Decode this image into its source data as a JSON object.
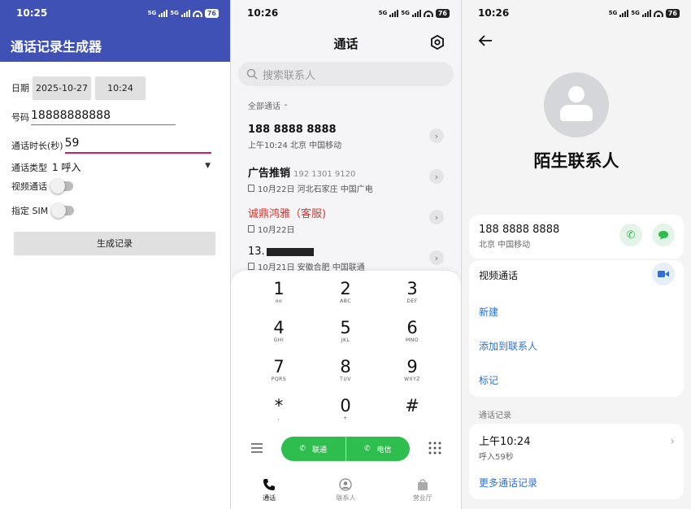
{
  "colors": {
    "primary": "#3f51b5",
    "green": "#2dbe4e",
    "red": "#d9342b",
    "blue": "#2f6fd6"
  },
  "p1": {
    "status": {
      "time": "10:25",
      "net": "5G",
      "battery": "76"
    },
    "app_title": "通话记录生成器",
    "date_label": "日期",
    "date_value": "2025-10-27",
    "time_value": "10:24",
    "number_label": "号码",
    "number_value": "18888888888",
    "duration_label": "通话时长(秒)",
    "duration_value": "59",
    "type_label": "通话类型",
    "type_value": "1 呼入",
    "video_label": "视频通话",
    "sim_label": "指定 SIM",
    "generate_label": "生成记录"
  },
  "p2": {
    "status": {
      "time": "10:26",
      "net": "5G",
      "battery": "76"
    },
    "title": "通话",
    "search_placeholder": "搜索联系人",
    "filter": "全部通话",
    "calls": [
      {
        "name": "188 8888 8888",
        "number": "",
        "sub": "上午10:24 北京 中国移动"
      },
      {
        "name": "广告推销",
        "number": "192 1301 9120",
        "sub": "10月22日 河北石家庄 中国广电"
      },
      {
        "name": "诚鼎鸿雅（客服)",
        "number": "",
        "sub": "10月22日"
      },
      {
        "name": "13.",
        "number": "",
        "sub": "10月21日 安徽合肥 中国联通"
      }
    ],
    "keys": [
      {
        "d": "1",
        "l": "oo"
      },
      {
        "d": "2",
        "l": "ABC"
      },
      {
        "d": "3",
        "l": "DEF"
      },
      {
        "d": "4",
        "l": "GHI"
      },
      {
        "d": "5",
        "l": "JKL"
      },
      {
        "d": "6",
        "l": "MNO"
      },
      {
        "d": "7",
        "l": "PQRS"
      },
      {
        "d": "8",
        "l": "TUV"
      },
      {
        "d": "9",
        "l": "WXYZ"
      },
      {
        "d": "*",
        "l": ","
      },
      {
        "d": "0",
        "l": "+"
      },
      {
        "d": "#",
        "l": ""
      }
    ],
    "call_unicom": "联通",
    "call_telecom": "电信",
    "tabs": [
      "通话",
      "联系人",
      "营业厅"
    ]
  },
  "p3": {
    "status": {
      "time": "10:26",
      "net": "5G",
      "battery": "76"
    },
    "contact_name": "陌生联系人",
    "number": "188 8888 8888",
    "location": "北京 中国移动",
    "video_call": "视频通话",
    "new": "新建",
    "add_contact": "添加到联系人",
    "mark": "标记",
    "history_label": "通话记录",
    "history_time": "上午10:24",
    "history_detail": "呼入59秒",
    "more_history": "更多通话记录"
  }
}
